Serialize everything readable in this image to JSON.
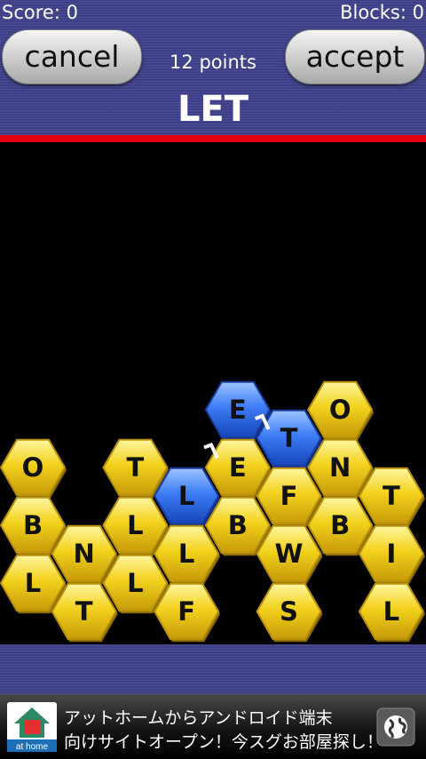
{
  "header": {
    "score_label": "Score: 0",
    "blocks_label": "Blocks: 0",
    "cancel_label": "cancel",
    "accept_label": "accept",
    "points_label": "12 points",
    "current_word": "LET"
  },
  "colors": {
    "header_blue": "#3d3f88",
    "red_bar": "#e00010",
    "board_bg": "#000000",
    "tile_yellow": "#f2d21c",
    "tile_blue": "#3c7cf6"
  },
  "board": {
    "tiles": [
      {
        "letter": "O",
        "col": 0,
        "row": 0,
        "selected": false
      },
      {
        "letter": "B",
        "col": 0,
        "row": 1,
        "selected": false
      },
      {
        "letter": "L",
        "col": 0,
        "row": 2,
        "selected": false
      },
      {
        "letter": "N",
        "col": 1,
        "row": 1,
        "selected": false
      },
      {
        "letter": "T",
        "col": 1,
        "row": 2,
        "selected": false
      },
      {
        "letter": "T",
        "col": 2,
        "row": 0,
        "selected": false
      },
      {
        "letter": "L",
        "col": 2,
        "row": 1,
        "selected": false
      },
      {
        "letter": "L",
        "col": 2,
        "row": 2,
        "selected": false
      },
      {
        "letter": "L",
        "col": 3,
        "row": 0,
        "selected": true
      },
      {
        "letter": "L",
        "col": 3,
        "row": 1,
        "selected": false
      },
      {
        "letter": "F",
        "col": 3,
        "row": 2,
        "selected": false
      },
      {
        "letter": "E",
        "col": 4,
        "row": -1,
        "selected": true
      },
      {
        "letter": "E",
        "col": 4,
        "row": 0,
        "selected": false
      },
      {
        "letter": "B",
        "col": 4,
        "row": 1,
        "selected": false
      },
      {
        "letter": "T",
        "col": 5,
        "row": -1,
        "selected": true
      },
      {
        "letter": "F",
        "col": 5,
        "row": 0,
        "selected": false
      },
      {
        "letter": "W",
        "col": 5,
        "row": 1,
        "selected": false
      },
      {
        "letter": "S",
        "col": 5,
        "row": 2,
        "selected": false
      },
      {
        "letter": "O",
        "col": 6,
        "row": -1,
        "selected": false
      },
      {
        "letter": "N",
        "col": 6,
        "row": 0,
        "selected": false
      },
      {
        "letter": "B",
        "col": 6,
        "row": 1,
        "selected": false
      },
      {
        "letter": "T",
        "col": 7,
        "row": 0,
        "selected": false
      },
      {
        "letter": "I",
        "col": 7,
        "row": 1,
        "selected": false
      },
      {
        "letter": "L",
        "col": 7,
        "row": 2,
        "selected": false
      }
    ]
  },
  "ad": {
    "logo_text": "at home",
    "line1": "アットホームからアンドロイド端末",
    "line2": "向けサイトオープン！今スグお部屋探し！",
    "globe_icon": "globe-icon"
  }
}
